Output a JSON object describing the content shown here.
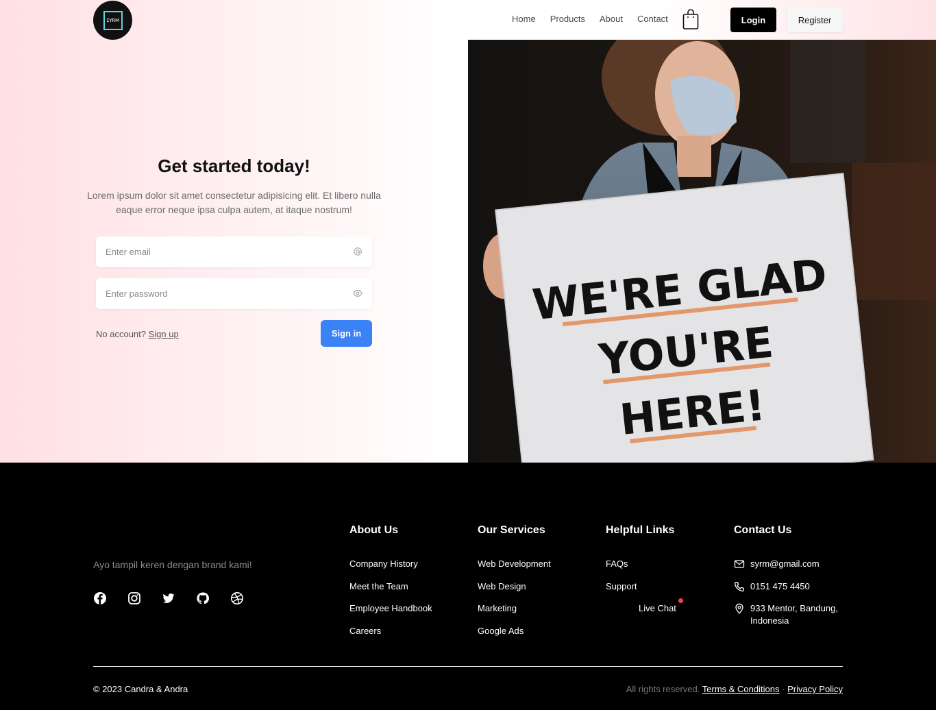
{
  "nav": {
    "logo_text": "ΣΥRM",
    "links": [
      "Home",
      "Products",
      "About",
      "Contact"
    ],
    "cart_icon": "shopping-bag-icon",
    "login_label": "Login",
    "register_label": "Register"
  },
  "hero": {
    "title": "Get started today!",
    "subtitle": "Lorem ipsum dolor sit amet consectetur adipisicing elit. Et libero nulla eaque error neque ipsa culpa autem, at itaque nostrum!",
    "email_placeholder": "Enter email",
    "password_placeholder": "Enter password",
    "no_account_text": "No account?",
    "signup_label": "Sign up",
    "signin_label": "Sign in",
    "sign_text": [
      "WE'RE GLAD",
      "YOU'RE",
      "HERE!"
    ]
  },
  "footer": {
    "tagline": "Ayo tampil keren dengan brand kami!",
    "socials": [
      "facebook-icon",
      "instagram-icon",
      "twitter-icon",
      "github-icon",
      "dribbble-icon"
    ],
    "about": {
      "title": "About Us",
      "items": [
        "Company History",
        "Meet the Team",
        "Employee Handbook",
        "Careers"
      ]
    },
    "services": {
      "title": "Our Services",
      "items": [
        "Web Development",
        "Web Design",
        "Marketing",
        "Google Ads"
      ]
    },
    "help": {
      "title": "Helpful Links",
      "items": [
        "FAQs",
        "Support",
        "Live Chat"
      ]
    },
    "contact": {
      "title": "Contact Us",
      "email": "syrm@gmail.com",
      "phone": "0151 475 4450",
      "address": "933 Mentor, Bandung, Indonesia"
    },
    "copyright": "© 2023 Candra & Andra",
    "rights": "All rights reserved.",
    "terms": "Terms & Conditions",
    "separator": "·",
    "privacy": "Privacy Policy"
  },
  "colors": {
    "accent": "#3b82f6",
    "live_dot": "#f43f5e",
    "footer_bg": "#000000"
  }
}
